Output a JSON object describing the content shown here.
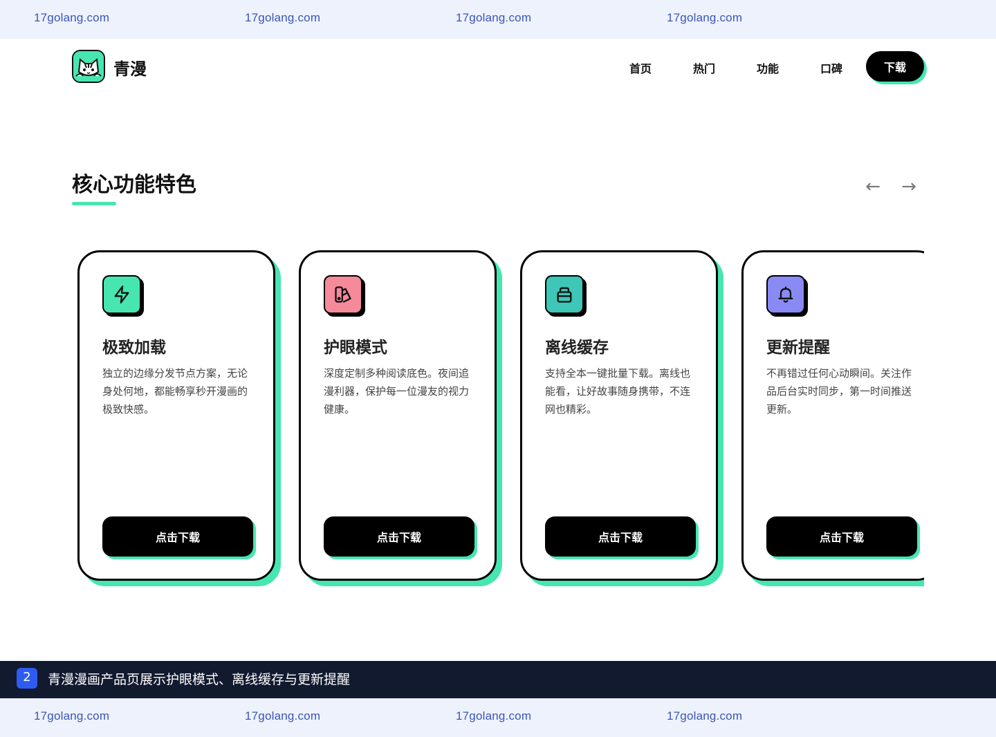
{
  "watermark": {
    "text": "17golang.com"
  },
  "header": {
    "brand": "青漫",
    "nav": [
      {
        "label": "首页"
      },
      {
        "label": "热门"
      },
      {
        "label": "功能"
      },
      {
        "label": "口碑"
      }
    ],
    "download_label": "下载"
  },
  "section": {
    "title": "核心功能特色",
    "prev_arrow": "←",
    "next_arrow": "→"
  },
  "cards": [
    {
      "icon": "lightning-icon",
      "title": "极致加载",
      "desc": "独立的边缘分发节点方案，无论身处何地，都能畅享秒开漫画的极致快感。",
      "button": "点击下载",
      "color": "#47e6b1"
    },
    {
      "icon": "palette-icon",
      "title": "护眼模式",
      "desc": "深度定制多种阅读底色。夜间追漫利器，保护每一位漫友的视力健康。",
      "button": "点击下载",
      "color": "#f58a9a"
    },
    {
      "icon": "archive-icon",
      "title": "离线缓存",
      "desc": "支持全本一键批量下载。离线也能看，让好故事随身携带，不连网也精彩。",
      "button": "点击下载",
      "color": "#3ec6b6"
    },
    {
      "icon": "bell-icon",
      "title": "更新提醒",
      "desc": "不再错过任何心动瞬间。关注作品后台实时同步，第一时间推送更新。",
      "button": "点击下载",
      "color": "#8a8af5"
    }
  ],
  "caption": {
    "number": "2",
    "text": "青漫漫画产品页展示护眼模式、离线缓存与更新提醒"
  },
  "colors": {
    "accent": "#47e6b1",
    "dark": "#000000",
    "caption_bg": "#121a2f",
    "watermark_bg": "#eef2fd"
  }
}
